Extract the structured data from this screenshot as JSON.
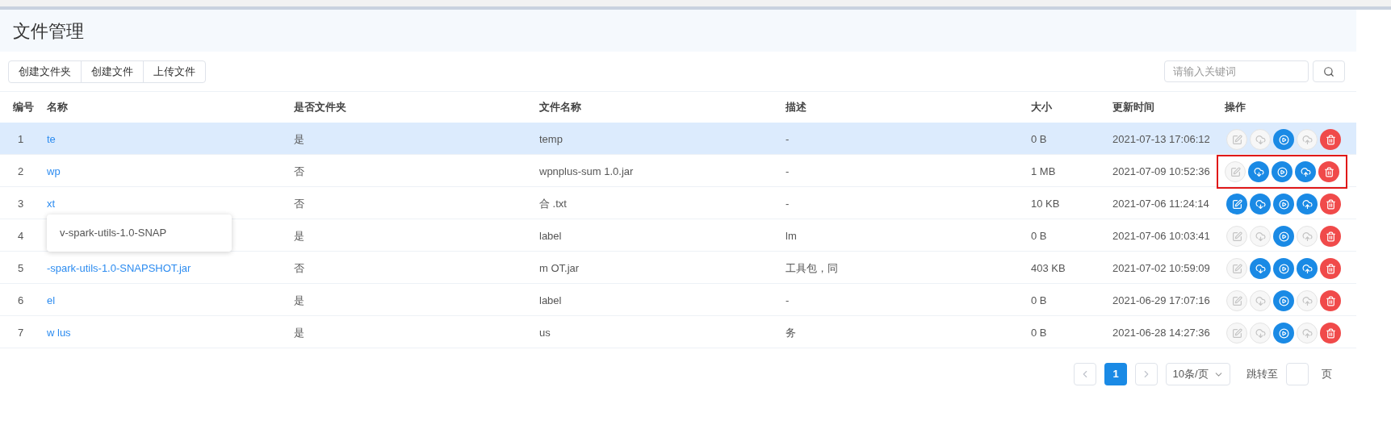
{
  "title": "文件管理",
  "toolbar_buttons": [
    "创建文件夹",
    "创建文件",
    "上传文件"
  ],
  "search": {
    "placeholder": "请输入关键词"
  },
  "table": {
    "columns": [
      "编号",
      "名称",
      "是否文件夹",
      "文件名称",
      "描述",
      "大小",
      "更新时间",
      "操作"
    ],
    "rows": [
      {
        "no": "1",
        "name": "te",
        "folder": "是",
        "file": "temp",
        "desc": "-",
        "size": "0 B",
        "time": "2021-07-13 17:06:12",
        "selected": true,
        "highlighted": false,
        "actions": [
          {
            "kind": "edit",
            "enabled": false
          },
          {
            "kind": "download",
            "enabled": false
          },
          {
            "kind": "run",
            "enabled": true
          },
          {
            "kind": "upload",
            "enabled": false
          },
          {
            "kind": "delete",
            "enabled": true
          }
        ]
      },
      {
        "no": "2",
        "name": "wp",
        "folder": "否",
        "file": "wpnplus-sum 1.0.jar",
        "desc": "-",
        "size": "1 MB",
        "time": "2021-07-09 10:52:36",
        "selected": false,
        "highlighted": true,
        "actions": [
          {
            "kind": "edit",
            "enabled": false
          },
          {
            "kind": "download",
            "enabled": true
          },
          {
            "kind": "run",
            "enabled": true
          },
          {
            "kind": "upload",
            "enabled": true
          },
          {
            "kind": "delete",
            "enabled": true
          }
        ]
      },
      {
        "no": "3",
        "name": "xt",
        "folder": "否",
        "file": "合 .txt",
        "desc": "-",
        "size": "10 KB",
        "time": "2021-07-06 11:24:14",
        "selected": false,
        "highlighted": false,
        "actions": [
          {
            "kind": "edit",
            "enabled": true
          },
          {
            "kind": "download",
            "enabled": true
          },
          {
            "kind": "run",
            "enabled": true
          },
          {
            "kind": "upload",
            "enabled": true
          },
          {
            "kind": "delete",
            "enabled": true
          }
        ]
      },
      {
        "no": "4",
        "folder": "是",
        "file": "label",
        "desc": "lm",
        "size": "0 B",
        "time": "2021-07-06 10:03:41",
        "selected": false,
        "highlighted": false,
        "tooltip": "v-spark-utils-1.0-SNAP",
        "actions": [
          {
            "kind": "edit",
            "enabled": false
          },
          {
            "kind": "download",
            "enabled": false
          },
          {
            "kind": "run",
            "enabled": true
          },
          {
            "kind": "upload",
            "enabled": false
          },
          {
            "kind": "delete",
            "enabled": true
          }
        ]
      },
      {
        "no": "5",
        "name": "-spark-utils-1.0-SNAPSHOT.jar",
        "folder": "否",
        "file": "m OT.jar",
        "desc": "工具包，同",
        "size": "403 KB",
        "time": "2021-07-02 10:59:09",
        "selected": false,
        "highlighted": false,
        "actions": [
          {
            "kind": "edit",
            "enabled": false
          },
          {
            "kind": "download",
            "enabled": true
          },
          {
            "kind": "run",
            "enabled": true
          },
          {
            "kind": "upload",
            "enabled": true
          },
          {
            "kind": "delete",
            "enabled": true
          }
        ]
      },
      {
        "no": "6",
        "name": "el",
        "folder": "是",
        "file": "label",
        "desc": "-",
        "size": "0 B",
        "time": "2021-06-29 17:07:16",
        "selected": false,
        "highlighted": false,
        "actions": [
          {
            "kind": "edit",
            "enabled": false
          },
          {
            "kind": "download",
            "enabled": false
          },
          {
            "kind": "run",
            "enabled": true
          },
          {
            "kind": "upload",
            "enabled": false
          },
          {
            "kind": "delete",
            "enabled": true
          }
        ]
      },
      {
        "no": "7",
        "name": "w lus",
        "folder": "是",
        "file": "us",
        "desc": "务",
        "size": "0 B",
        "time": "2021-06-28 14:27:36",
        "selected": false,
        "highlighted": false,
        "actions": [
          {
            "kind": "edit",
            "enabled": false
          },
          {
            "kind": "download",
            "enabled": false
          },
          {
            "kind": "run",
            "enabled": true
          },
          {
            "kind": "upload",
            "enabled": false
          },
          {
            "kind": "delete",
            "enabled": true
          }
        ]
      }
    ]
  },
  "pagination": {
    "pages": [
      {
        "label": "1",
        "selected": true
      }
    ],
    "page_size": "10条/页",
    "jump_label": "跳转至",
    "page_unit": "页"
  }
}
